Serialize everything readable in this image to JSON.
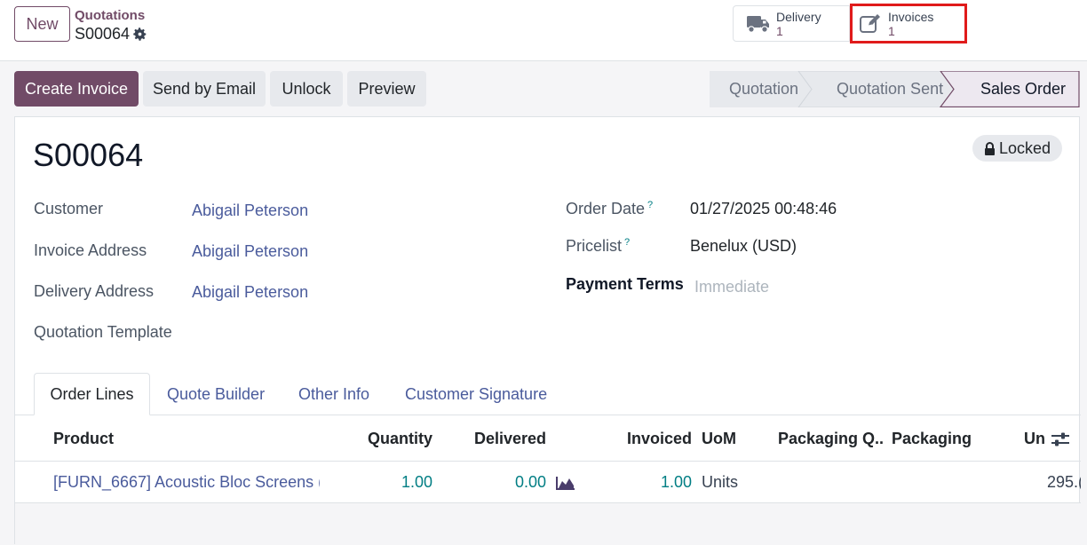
{
  "topbar": {
    "new_label": "New",
    "breadcrumb": "Quotations",
    "record": "S00064",
    "delivery_label": "Delivery",
    "delivery_count": "1",
    "invoices_label": "Invoices",
    "invoices_count": "1"
  },
  "actions": {
    "create_invoice": "Create Invoice",
    "send_email": "Send by Email",
    "unlock": "Unlock",
    "preview": "Preview"
  },
  "status": {
    "steps": [
      "Quotation",
      "Quotation Sent",
      "Sales Order"
    ],
    "current": "Sales Order"
  },
  "sheet": {
    "title": "S00064",
    "badge": "Locked",
    "fields": {
      "customer_label": "Customer",
      "customer_value": "Abigail Peterson",
      "invoice_address_label": "Invoice Address",
      "invoice_address_value": "Abigail Peterson",
      "delivery_address_label": "Delivery Address",
      "delivery_address_value": "Abigail Peterson",
      "quotation_template_label": "Quotation Template",
      "order_date_label": "Order Date",
      "order_date_value": "01/27/2025 00:48:46",
      "pricelist_label": "Pricelist",
      "pricelist_value": "Benelux (USD)",
      "payment_terms_label": "Payment Terms",
      "payment_terms_placeholder": "Immediate",
      "help_mark": "?"
    }
  },
  "tabs": [
    "Order Lines",
    "Quote Builder",
    "Other Info",
    "Customer Signature"
  ],
  "table": {
    "headers": {
      "product": "Product",
      "quantity": "Quantity",
      "delivered": "Delivered",
      "invoiced": "Invoiced",
      "uom": "UoM",
      "packaging_qty": "Packaging Q...",
      "packaging": "Packaging",
      "unit_price": "Un"
    },
    "rows": [
      {
        "product": "[FURN_6667] Acoustic Bloc Screens (...",
        "quantity": "1.00",
        "delivered": "0.00",
        "invoiced": "1.00",
        "uom": "Units",
        "unit_price": "295.("
      }
    ]
  },
  "colors": {
    "brand": "#714b67",
    "highlight_border": "#e01b1b",
    "link": "#4a5b9c",
    "number": "#017e84"
  }
}
